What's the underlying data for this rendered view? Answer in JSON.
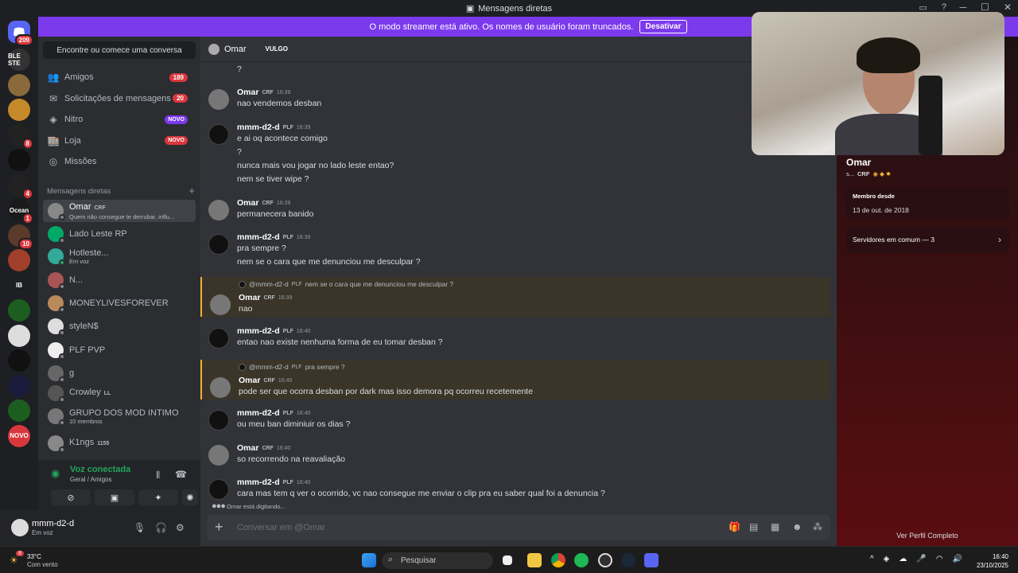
{
  "window": {
    "title": "Mensagens diretas"
  },
  "banner": {
    "text": "O modo streamer está ativo. Os nomes de usuário foram truncados.",
    "button": "Desativar"
  },
  "guilds": {
    "home_badge": "209",
    "items": [
      {
        "name": "BLE STE",
        "badge": ""
      },
      {
        "name": "",
        "badge": ""
      },
      {
        "name": "",
        "badge": ""
      },
      {
        "name": "",
        "badge": "8"
      },
      {
        "name": "",
        "badge": ""
      },
      {
        "name": "",
        "badge": "4"
      },
      {
        "name": "Ocean",
        "badge": "1"
      },
      {
        "name": "",
        "badge": "10"
      },
      {
        "name": "",
        "badge": ""
      },
      {
        "name": "IB",
        "badge": ""
      },
      {
        "name": "",
        "badge": ""
      },
      {
        "name": "",
        "badge": ""
      },
      {
        "name": "",
        "badge": ""
      },
      {
        "name": "",
        "badge": ""
      },
      {
        "name": "",
        "badge": ""
      },
      {
        "name": "NOVO",
        "badge": ""
      }
    ]
  },
  "sidebar": {
    "find": "Encontre ou comece uma conversa",
    "nav": [
      {
        "label": "Amigos",
        "badge": "189"
      },
      {
        "label": "Solicitações de mensagens",
        "badge": "20"
      },
      {
        "label": "Nitro",
        "badge": "NOVO"
      },
      {
        "label": "Loja",
        "badge": "NOVO"
      },
      {
        "label": "Missões",
        "badge": ""
      }
    ],
    "dm_header": "Mensagens diretas",
    "dms": [
      {
        "name": "Omar",
        "tag": "CRF",
        "sub": "Quem não consegue te derrubar, influ..."
      },
      {
        "name": "Lado Leste RP",
        "tag": "",
        "sub": ""
      },
      {
        "name": "Hotleste...",
        "tag": "",
        "sub": "Em voz"
      },
      {
        "name": "N...",
        "tag": "",
        "sub": ""
      },
      {
        "name": "MONEYLIVESFOREVER",
        "tag": "",
        "sub": ""
      },
      {
        "name": "styleN$",
        "tag": "",
        "sub": ""
      },
      {
        "name": "PLF PVP",
        "tag": "",
        "sub": ""
      },
      {
        "name": "g",
        "tag": "",
        "sub": ""
      },
      {
        "name": "Crowley",
        "tag": "LL",
        "sub": ""
      },
      {
        "name": "GRUPO DOS MOD INTIMO",
        "tag": "",
        "sub": "10 membros"
      },
      {
        "name": "K1ngs",
        "tag": "1155",
        "sub": ""
      }
    ]
  },
  "voice": {
    "title": "Voz conectada",
    "sub": "Geral / Amigos"
  },
  "user": {
    "name": "mmm-d2-d",
    "status": "Em voz"
  },
  "chat": {
    "header_name": "Omar",
    "header_tag": "VULGO",
    "top_line": "?",
    "messages": [
      {
        "author": "Omar",
        "tag": "CRF",
        "time": "16:38",
        "lines": [
          "nao vendemos desban"
        ],
        "reply": null
      },
      {
        "author": "mmm-d2-d",
        "tag": "PLF",
        "time": "16:39",
        "lines": [
          "e ai oq acontece comigo",
          "?",
          "nunca mais vou jogar no lado leste entao?",
          "nem se tiver wipe ?"
        ],
        "reply": null
      },
      {
        "author": "Omar",
        "tag": "CRF",
        "time": "16:39",
        "lines": [
          "permanecera banido"
        ],
        "reply": null
      },
      {
        "author": "mmm-d2-d",
        "tag": "PLF",
        "time": "16:39",
        "lines": [
          "pra sempre ?",
          "nem se o cara que me denunciou me desculpar ?"
        ],
        "reply": null
      },
      {
        "author": "Omar",
        "tag": "CRF",
        "time": "16:39",
        "lines": [
          "nao"
        ],
        "reply": {
          "user": "@mmm-d2-d",
          "tag": "PLF",
          "text": "nem se o cara que me denunciou me desculpar ?"
        }
      },
      {
        "author": "mmm-d2-d",
        "tag": "PLF",
        "time": "16:40",
        "lines": [
          "entao nao existe nenhuma forma de eu tomar desban ?"
        ],
        "reply": null
      },
      {
        "author": "Omar",
        "tag": "CRF",
        "time": "16:40",
        "lines": [
          "pode ser que ocorra desban por dark mas isso demora pq ocorreu recetemente"
        ],
        "reply": {
          "user": "@mmm-d2-d",
          "tag": "PLF",
          "text": "pra sempre ?"
        }
      },
      {
        "author": "mmm-d2-d",
        "tag": "PLF",
        "time": "16:40",
        "lines": [
          "ou meu ban diminiuir os dias ?"
        ],
        "reply": null
      },
      {
        "author": "Omar",
        "tag": "CRF",
        "time": "16:40",
        "lines": [
          "so recorrendo na reavaliação"
        ],
        "reply": null
      },
      {
        "author": "mmm-d2-d",
        "tag": "PLF",
        "time": "16:40",
        "lines": [
          "cara mas tem q ver o ocorrido, vc nao consegue me enviar o clip pra eu saber qual foi a denuncia ?"
        ],
        "reply": null
      }
    ],
    "typing": "Omar está digitando...",
    "input_placeholder": "Conversar em @Omar"
  },
  "profile": {
    "name": "Omar",
    "tag_prefix": "s...",
    "tag": "CRF",
    "member_since_label": "Membro desde",
    "member_since": "13 de out. de 2018",
    "mutual_servers": "Servidores em comum — 3",
    "view_full": "Ver Perfil Completo"
  },
  "taskbar": {
    "weather_temp": "33°C",
    "weather_desc": "Com vento",
    "weather_badge": "8",
    "search": "Pesquisar",
    "time": "16:40",
    "date": "23/10/2025"
  },
  "colors": {
    "accent": "#5865f2",
    "banner": "#7c3aed",
    "online": "#23a55a",
    "danger": "#da373c"
  }
}
